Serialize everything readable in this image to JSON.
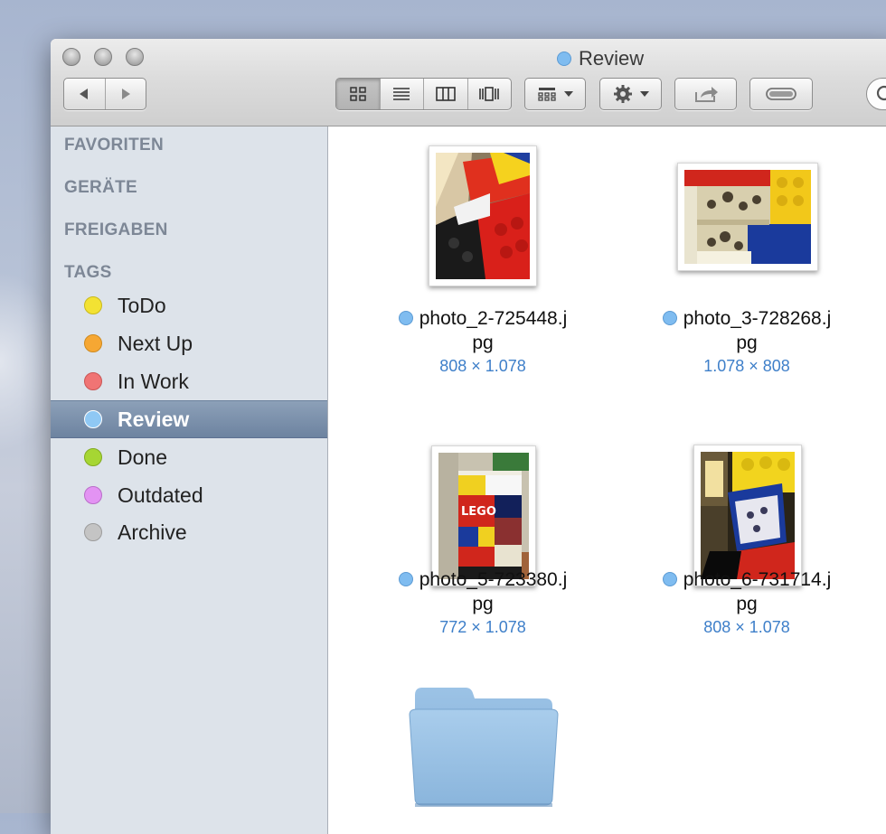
{
  "window": {
    "title": "Review",
    "title_tag_color": "#7fbcf0"
  },
  "toolbar": {
    "back_icon": "triangle-left-icon",
    "forward_icon": "triangle-right-icon",
    "views": [
      "icon-view",
      "list-view",
      "column-view",
      "coverflow-view"
    ],
    "active_view": "icon-view"
  },
  "sidebar": {
    "sections": [
      "FAVORITEN",
      "GERÄTE",
      "FREIGABEN",
      "TAGS"
    ],
    "tags": [
      {
        "label": "ToDo",
        "color": "#f3e233"
      },
      {
        "label": "Next Up",
        "color": "#f6a733"
      },
      {
        "label": "In Work",
        "color": "#f07474"
      },
      {
        "label": "Review",
        "color": "#8fc8f4",
        "selected": true
      },
      {
        "label": "Done",
        "color": "#a6d633"
      },
      {
        "label": "Outdated",
        "color": "#e393f3"
      },
      {
        "label": "Archive",
        "color": "#c4c4c4"
      }
    ]
  },
  "files": [
    {
      "name_line1": "photo_2-725448.j",
      "name_line2": "pg",
      "dims": "808 × 1.078"
    },
    {
      "name_line1": "photo_3-728268.j",
      "name_line2": "pg",
      "dims": "1.078 × 808"
    },
    {
      "name_line1": "photo_5-723380.j",
      "name_line2": "pg",
      "dims": "772 × 1.078"
    },
    {
      "name_line1": "photo_6-731714.j",
      "name_line2": "pg",
      "dims": "808 × 1.078"
    }
  ],
  "photo_text": "LEGO"
}
